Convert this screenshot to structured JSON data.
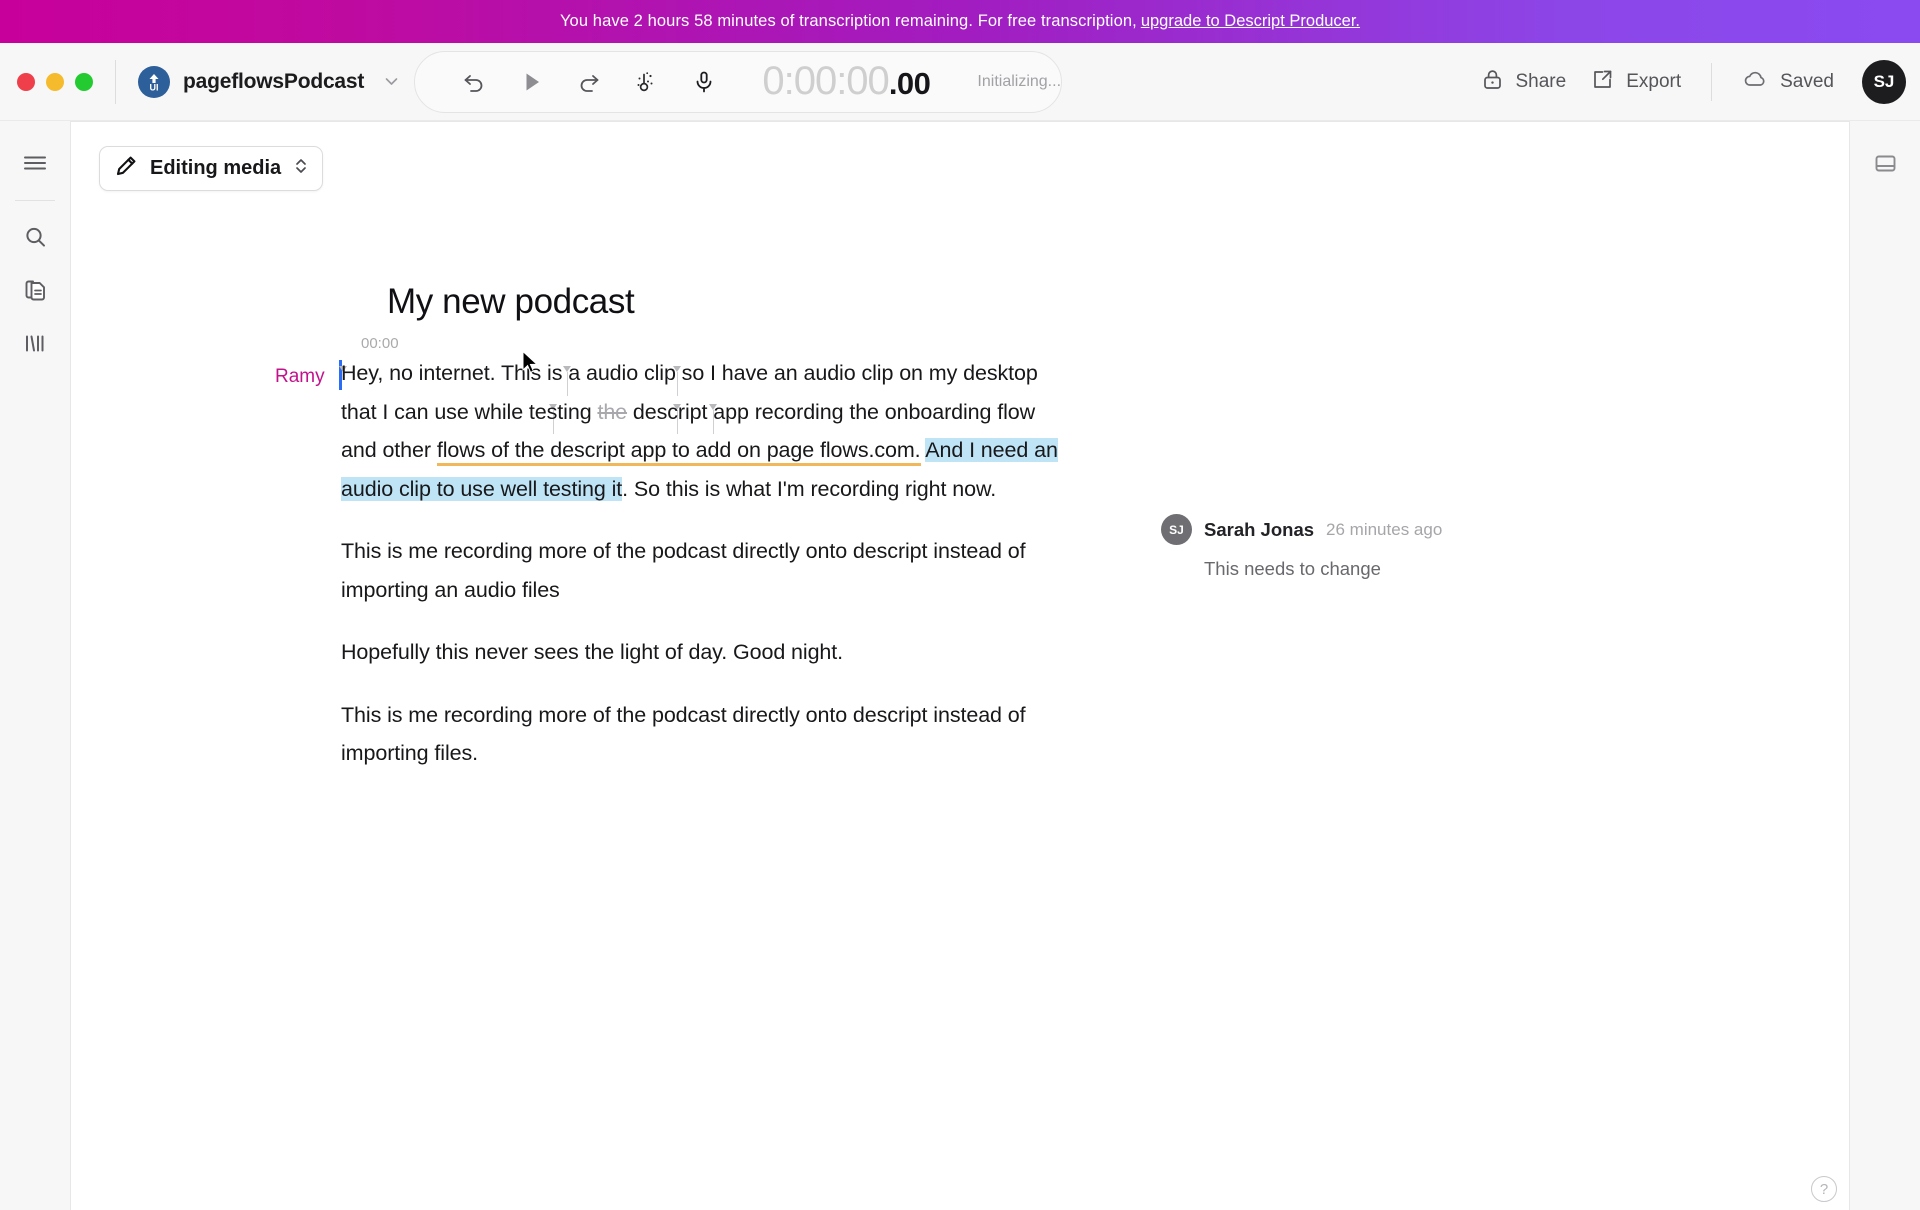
{
  "banner": {
    "message": "You have 2 hours 58 minutes of transcription remaining. For free transcription,",
    "link_label": "upgrade to Descript Producer.",
    "gradient_start": "#c8009b",
    "gradient_end": "#8a4af0"
  },
  "titlebar": {
    "window_controls": [
      "close",
      "minimize",
      "zoom"
    ],
    "project_name": "pageflowsPodcast",
    "logo_text": "UI",
    "transport": {
      "undo_label": "Undo",
      "play_label": "Play",
      "redo_label": "Redo",
      "tools_label": "Tools",
      "record_label": "Record",
      "timecode_main": "0:00:00",
      "timecode_frames": ".00",
      "status": "Initializing..."
    },
    "share_label": "Share",
    "export_label": "Export",
    "saved_label": "Saved",
    "avatar_initials": "SJ"
  },
  "left_rail": {
    "items": [
      {
        "name": "menu",
        "icon": "hamburger-icon"
      },
      {
        "name": "search",
        "icon": "search-icon"
      },
      {
        "name": "documents",
        "icon": "documents-icon"
      },
      {
        "name": "timeline",
        "icon": "waveform-icon"
      }
    ]
  },
  "right_rail": {
    "items": [
      {
        "name": "layout-panel",
        "icon": "panel-icon"
      }
    ],
    "help_label": "?"
  },
  "editor": {
    "mode_label": "Editing media",
    "mode_icon": "pencil-icon",
    "doc_heading": "My new podcast",
    "speaker": "Ramy",
    "timestamp": "00:00",
    "paragraphs": [
      {
        "id": "p1",
        "segments": [
          {
            "text": "Hey, no internet. This is a audio clip so I have an audio clip on my desktop that I can use while testing ",
            "style": "normal"
          },
          {
            "text": "the",
            "style": "strike"
          },
          {
            "text": " descript app recording the onboarding flow and other ",
            "style": "normal"
          },
          {
            "text": "flows of the descript app to add on page flows.com.",
            "style": "underline"
          },
          {
            "text": " ",
            "style": "normal"
          },
          {
            "text": "And I need an audio clip to use well testing it",
            "style": "highlight"
          },
          {
            "text": ". So this is what I'm recording right now.",
            "style": "normal"
          }
        ]
      },
      {
        "id": "p2",
        "segments": [
          {
            "text": "This is me recording more of the podcast directly onto descript instead of importing an audio files",
            "style": "normal"
          }
        ]
      },
      {
        "id": "p3",
        "segments": [
          {
            "text": "Hopefully this never sees the light of day.  Good night.",
            "style": "normal"
          }
        ]
      },
      {
        "id": "p4",
        "segments": [
          {
            "text": "This is me recording more of the podcast directly onto descript instead of importing  files.",
            "style": "normal"
          }
        ]
      }
    ]
  },
  "comment": {
    "author_initials": "SJ",
    "author": "Sarah Jonas",
    "time": "26 minutes ago",
    "body": "This needs to change"
  },
  "colors": {
    "speaker": "#c2138c",
    "highlight": "#bfe4f5",
    "underline": "#f0b85a",
    "cursor": "#2b6cf6"
  }
}
